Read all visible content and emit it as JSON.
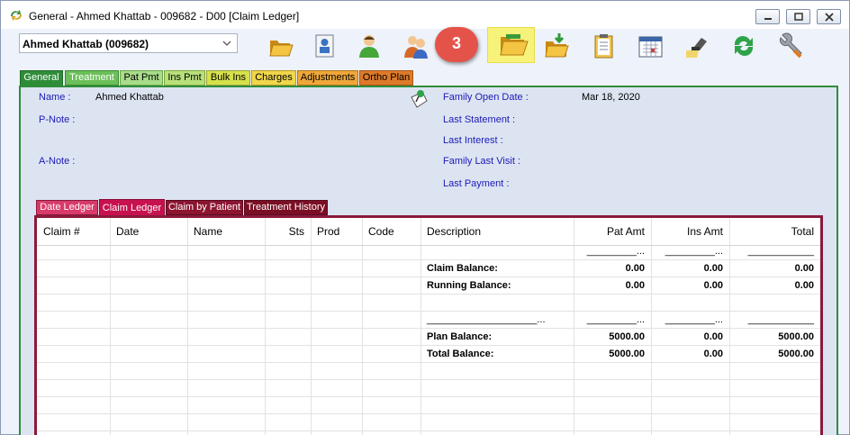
{
  "window": {
    "title": "General - Ahmed Khattab - 009682 - D00 [Claim Ledger]"
  },
  "toolbar": {
    "patient_select": "Ahmed Khattab (009682)",
    "icons": [
      "open-folder-icon",
      "patient-card-icon",
      "person-icon",
      "family-icon",
      "folder-highlight-icon",
      "folder-download-icon",
      "clipboard-icon",
      "calendar-icon",
      "stamp-icon",
      "refresh-icon",
      "wrench-icon"
    ],
    "callout_number": "3"
  },
  "tabs": [
    "General",
    "Treatment",
    "Pat Pmt",
    "Ins Pmt",
    "Bulk Ins",
    "Charges",
    "Adjustments",
    "Ortho Plan"
  ],
  "info": {
    "name_label": "Name :",
    "name_value": "Ahmed Khattab",
    "pnote_label": "P-Note :",
    "anote_label": "A-Note :",
    "family_open_date_label": "Family Open Date :",
    "family_open_date_value": "Mar 18, 2020",
    "last_statement_label": "Last Statement :",
    "last_interest_label": "Last Interest :",
    "family_last_visit_label": "Family Last Visit :",
    "last_payment_label": "Last Payment :"
  },
  "subtabs": [
    "Date Ledger",
    "Claim Ledger",
    "Claim by Patient",
    "Treatment History"
  ],
  "grid": {
    "headers": [
      "Claim #",
      "Date",
      "Name",
      "Sts",
      "Prod",
      "Code",
      "Description",
      "Pat Amt",
      "Ins Amt",
      "Total"
    ],
    "rule_short": "_________...",
    "rule_total": "____________",
    "rule_desc": "____________________...",
    "claim_balance": {
      "label": "Claim Balance:",
      "pat": "0.00",
      "ins": "0.00",
      "total": "0.00"
    },
    "running_balance": {
      "label": "Running Balance:",
      "pat": "0.00",
      "ins": "0.00",
      "total": "0.00"
    },
    "plan_balance": {
      "label": "Plan Balance:",
      "pat": "5000.00",
      "ins": "0.00",
      "total": "5000.00"
    },
    "total_balance": {
      "label": "Total Balance:",
      "pat": "5000.00",
      "ins": "0.00",
      "total": "5000.00"
    }
  }
}
